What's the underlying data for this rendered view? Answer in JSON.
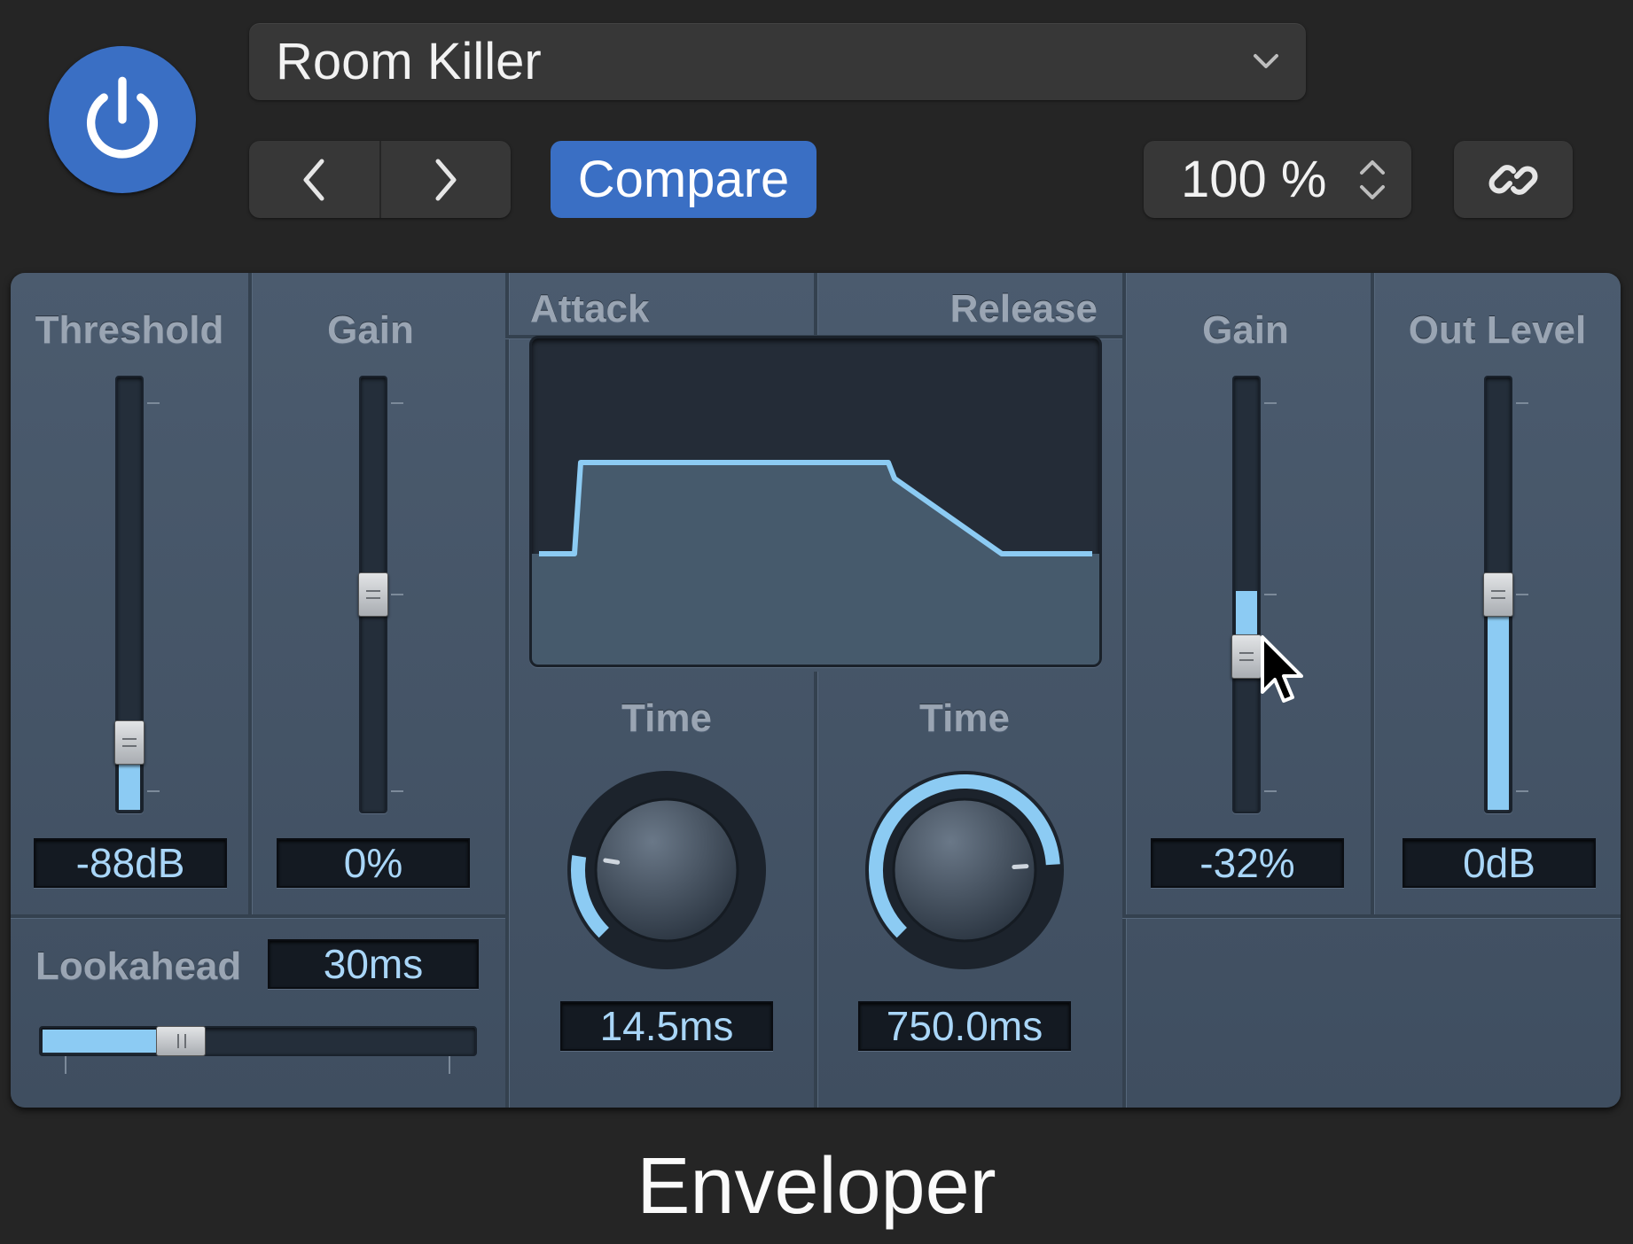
{
  "header": {
    "preset_name": "Room Killer",
    "compare_label": "Compare",
    "zoom_value": "100 %",
    "accent_color": "#3a6fc4"
  },
  "panel": {
    "threshold": {
      "label": "Threshold",
      "value": "-88dB",
      "fill_fraction": 0.12
    },
    "pre_gain": {
      "label": "Gain",
      "value": "0%",
      "fill_fraction": 0.5
    },
    "attack": {
      "header": "Attack",
      "time_label": "Time",
      "value": "14.5ms",
      "knob_fraction": 0.2
    },
    "release": {
      "header": "Release",
      "time_label": "Time",
      "value": "750.0ms",
      "knob_fraction": 0.82
    },
    "post_gain": {
      "label": "Gain",
      "value": "-32%",
      "fill_fraction": 0.34
    },
    "out_level": {
      "label": "Out Level",
      "value": "0dB",
      "fill_fraction": 0.5
    },
    "lookahead": {
      "label": "Lookahead",
      "value": "30ms",
      "fill_fraction": 0.3
    }
  },
  "plugin_name": "Enveloper"
}
